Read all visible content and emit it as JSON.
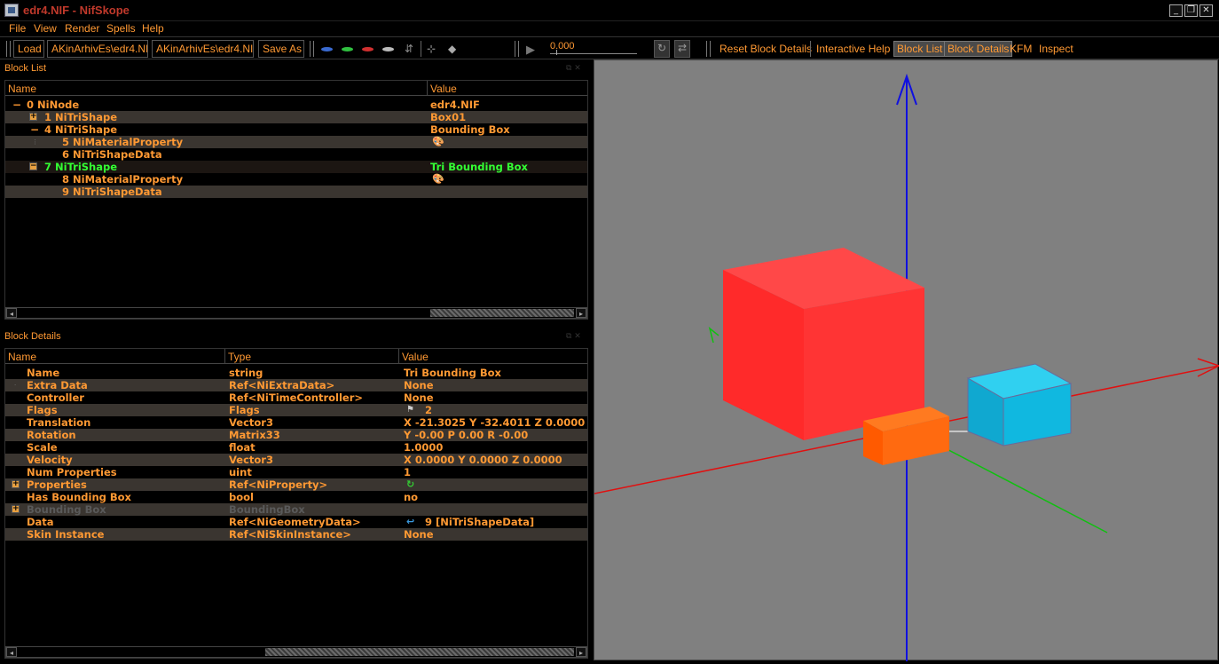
{
  "window": {
    "title": "edr4.NIF - NifSkope"
  },
  "menu": [
    "File",
    "View",
    "Render",
    "Spells",
    "Help"
  ],
  "toolbar": {
    "load": "Load",
    "path1": "AKinArhivEs\\edr4.NIF",
    "path2": "AKinArhivEs\\edr4.NIF",
    "save_as": "Save As",
    "time_value": "0.000",
    "reset_block_details": "Reset Block Details",
    "interactive_help": "Interactive Help",
    "block_list": "Block List",
    "block_details": "Block Details",
    "kfm": "KFM",
    "inspect": "Inspect"
  },
  "block_list": {
    "title": "Block List",
    "headers": [
      "Name",
      "Value"
    ],
    "rows": [
      {
        "name": "0 NiNode",
        "value": "edr4.NIF"
      },
      {
        "name": "1 NiTriShape",
        "value": "Box01"
      },
      {
        "name": "4 NiTriShape",
        "value": "Bounding Box"
      },
      {
        "name": "5 NiMaterialProperty",
        "value": ""
      },
      {
        "name": "6 NiTriShapeData",
        "value": ""
      },
      {
        "name": "7 NiTriShape",
        "value": "Tri Bounding Box"
      },
      {
        "name": "8 NiMaterialProperty",
        "value": ""
      },
      {
        "name": "9 NiTriShapeData",
        "value": ""
      }
    ]
  },
  "block_details": {
    "title": "Block Details",
    "headers": [
      "Name",
      "Type",
      "Value"
    ],
    "rows": [
      {
        "name": "Name",
        "type": "string",
        "value": "Tri Bounding Box"
      },
      {
        "name": "Extra Data",
        "type": "Ref<NiExtraData>",
        "value": "None"
      },
      {
        "name": "Controller",
        "type": "Ref<NiTimeController>",
        "value": "None"
      },
      {
        "name": "Flags",
        "type": "Flags",
        "value": "2"
      },
      {
        "name": "Translation",
        "type": "Vector3",
        "value": "X -21.3025 Y -32.4011 Z 0.0000"
      },
      {
        "name": "Rotation",
        "type": "Matrix33",
        "value": "Y -0.00 P 0.00 R -0.00"
      },
      {
        "name": "Scale",
        "type": "float",
        "value": "1.0000"
      },
      {
        "name": "Velocity",
        "type": "Vector3",
        "value": "X 0.0000 Y 0.0000 Z 0.0000"
      },
      {
        "name": "Num Properties",
        "type": "uint",
        "value": "1"
      },
      {
        "name": "Properties",
        "type": "Ref<NiProperty>",
        "value": ""
      },
      {
        "name": "Has Bounding Box",
        "type": "bool",
        "value": "no"
      },
      {
        "name": "Bounding Box",
        "type": "BoundingBox",
        "value": ""
      },
      {
        "name": "Data",
        "type": "Ref<NiGeometryData>",
        "value": "9 [NiTriShapeData]"
      },
      {
        "name": "Skin Instance",
        "type": "Ref<NiSkinInstance>",
        "value": "None"
      }
    ]
  },
  "colors": {
    "text": "#ff9933",
    "selected_text": "#33ff33",
    "title_text": "#c0392b",
    "viewport_bg": "#808080",
    "axis_x": "#e01010",
    "axis_y": "#10c010",
    "axis_z": "#1010e0",
    "box_red": "#ff2a2a",
    "box_orange": "#ff6a10",
    "box_cyan": "#10b8e0"
  }
}
